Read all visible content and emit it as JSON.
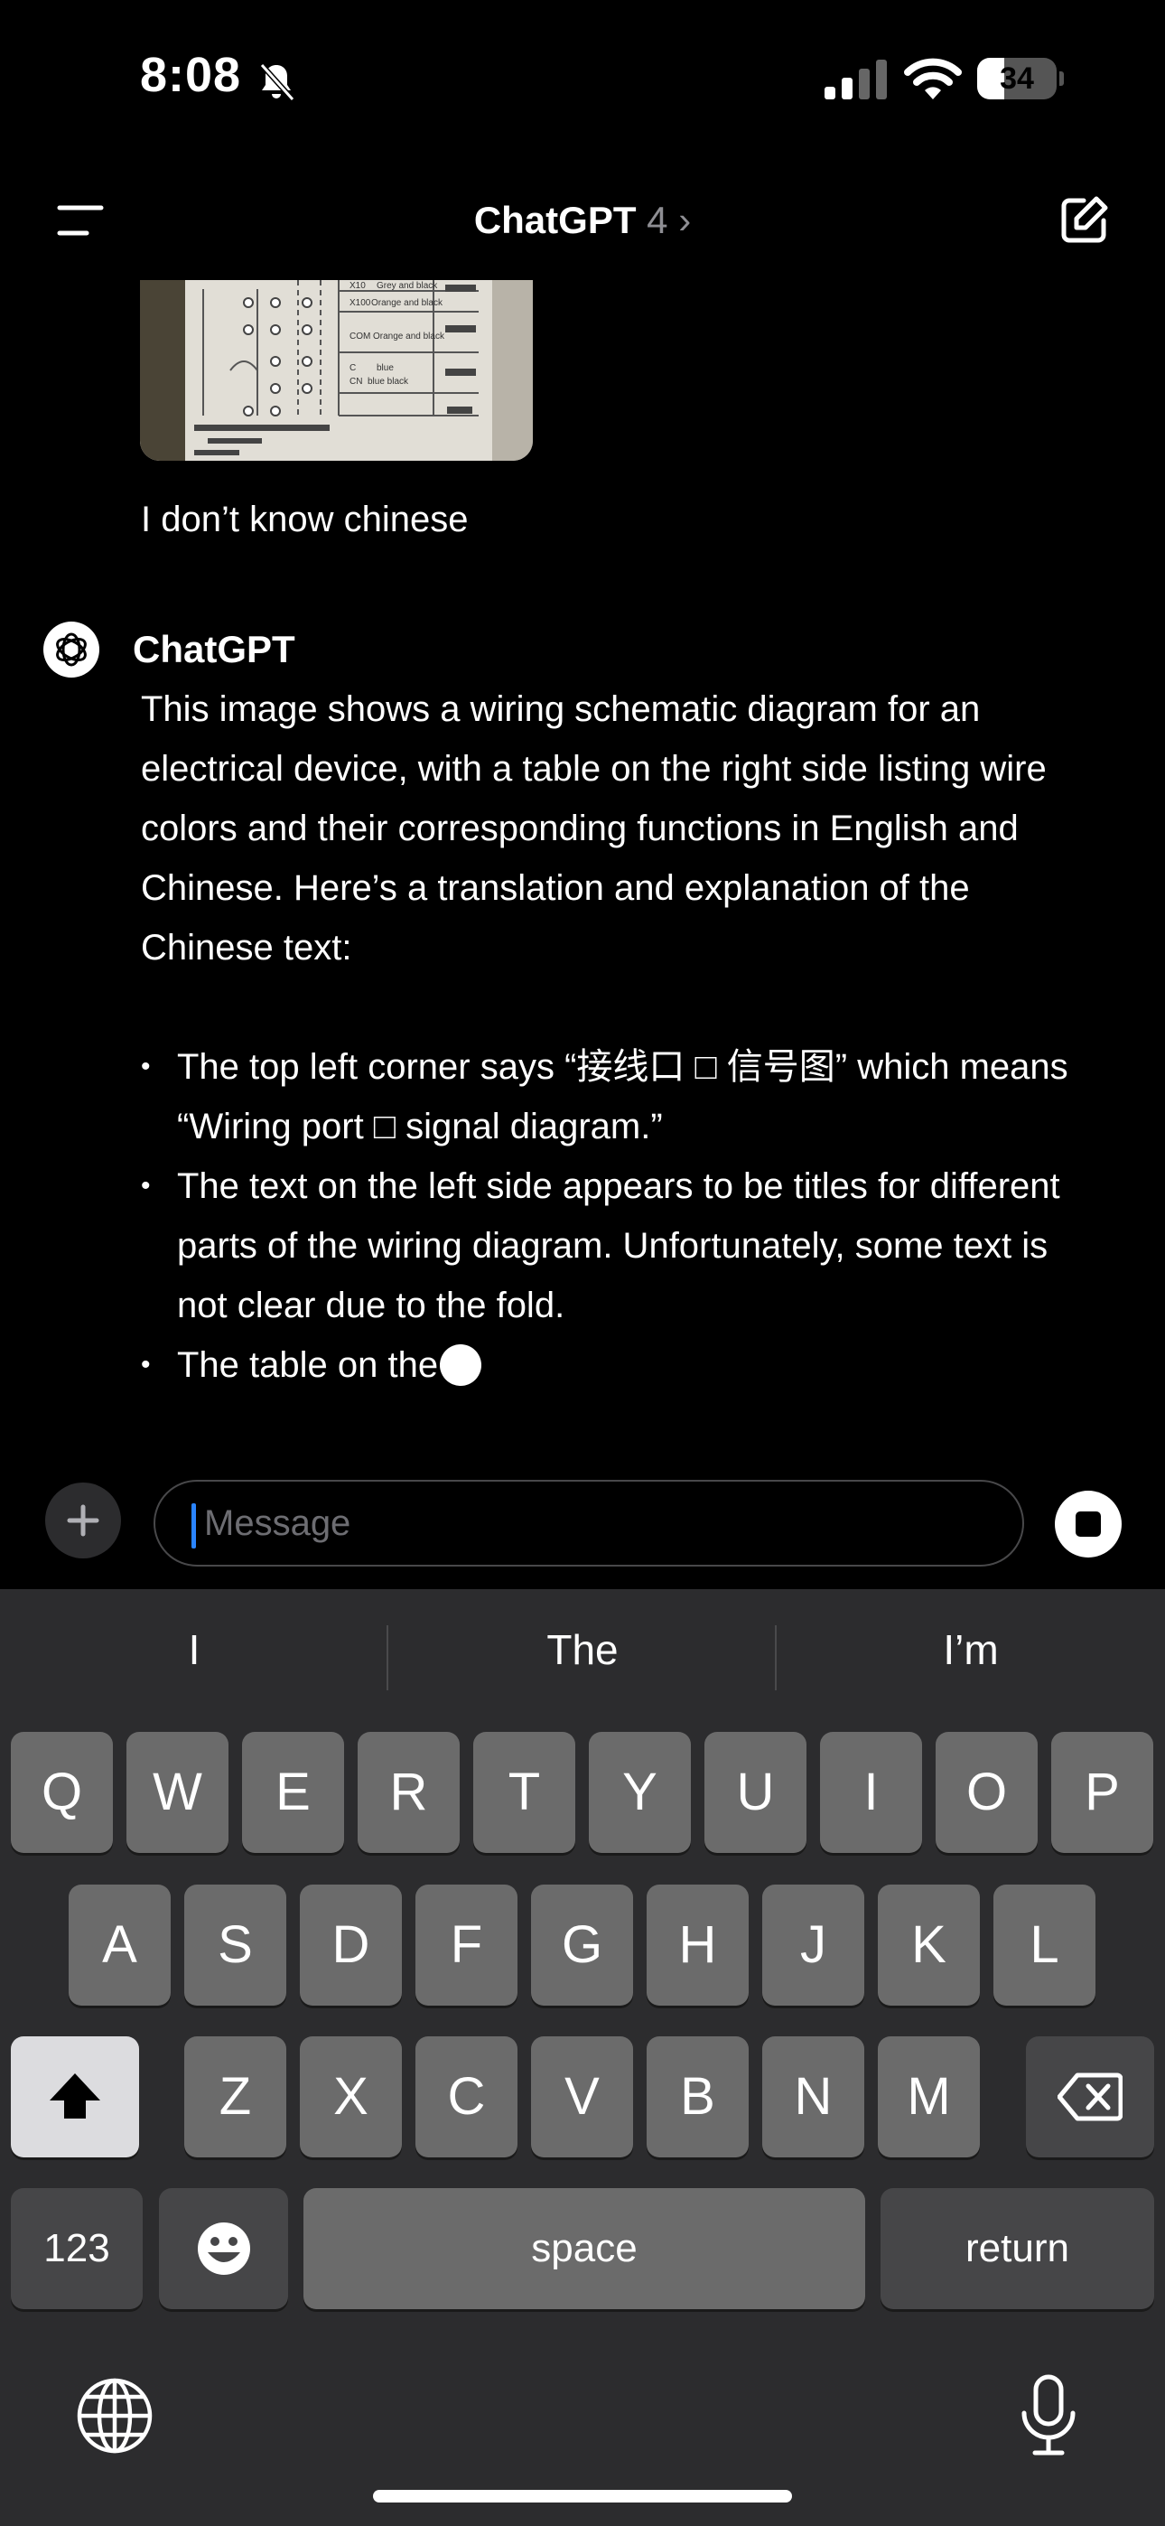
{
  "status_bar": {
    "time": "8:08",
    "battery": "34",
    "battery_fraction": 0.34
  },
  "nav": {
    "title": "ChatGPT",
    "version": "4",
    "chevron": "›"
  },
  "chat": {
    "user_message": "I don’t know chinese",
    "assistant_name": "ChatGPT",
    "assistant_intro": "This image shows a wiring schematic diagram for an electrical device, with a table on the right side listing wire colors and their corresponding functions in English and Chinese. Here’s a translation and explanation of the Chinese text:",
    "bullets": [
      "The top left corner says “接线口 □ 信号图” which means “Wiring port □ signal diagram.”",
      "The text on the left side appears to be titles for different parts of the wiring diagram. Unfortunately, some text is not clear due to the fold.",
      "The table on the"
    ],
    "image_snippets": [
      "X10",
      "Grey and black",
      "X100",
      "Orange and black",
      "COM",
      "Orange and black",
      "C",
      "blue",
      "CN",
      "blue black"
    ]
  },
  "composer": {
    "placeholder": "Message"
  },
  "keyboard": {
    "suggestions": [
      "I",
      "The",
      "I’m"
    ],
    "row1": [
      "Q",
      "W",
      "E",
      "R",
      "T",
      "Y",
      "U",
      "I",
      "O",
      "P"
    ],
    "row2": [
      "A",
      "S",
      "D",
      "F",
      "G",
      "H",
      "J",
      "K",
      "L"
    ],
    "row3": [
      "Z",
      "X",
      "C",
      "V",
      "B",
      "N",
      "M"
    ],
    "numbers_label": "123",
    "space_label": "space",
    "return_label": "return"
  },
  "icons": {
    "menu": "menu-icon",
    "compose": "compose-icon",
    "bell": "bell-slash-icon",
    "signal": "signal-icon",
    "wifi": "wifi-icon",
    "plus": "plus-icon",
    "stop": "stop-icon",
    "shift": "shift-icon",
    "delete": "backspace-icon",
    "emoji": "emoji-icon",
    "globe": "globe-icon",
    "mic": "microphone-icon"
  }
}
